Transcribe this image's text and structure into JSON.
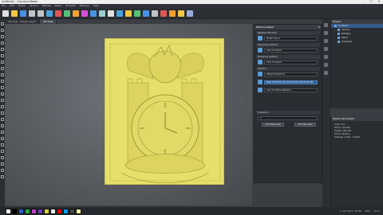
{
  "titlebar": {
    "title": "Untitled1 - Carveco Maker",
    "minimize": "–",
    "maximize": "□",
    "close": "✕"
  },
  "menubar": [
    "File",
    "Edit",
    "Model",
    "Vectors",
    "Bitmap",
    "Relief",
    "Toolpath",
    "Window",
    "Help"
  ],
  "tabs": [
    {
      "label": "2D View - Design Layer",
      "active": false
    },
    {
      "label": "3D View",
      "active": true
    }
  ],
  "toolbar_icons": [
    "new-icon",
    "open-icon",
    "save-icon",
    "undo-icon",
    "redo-icon",
    "vector-icon",
    "node-icon",
    "transform-icon",
    "bitmap-icon",
    "relief-icon",
    "shape-icon",
    "layer-icon",
    "merge-icon",
    "smooth-icon",
    "sculpt-icon",
    "toolpath-icon",
    "simulate-icon",
    "export-icon",
    "render-icon",
    "colour-icon",
    "light-icon",
    "view-icon"
  ],
  "palette_colors": [
    "#ffffff",
    "#000000",
    "#2b5fd1",
    "#2fa84c",
    "#c13cc1",
    "#6b3bc4",
    "#d9d435",
    "#e8e8e8",
    "#ff0000",
    "#00a0e9",
    "#444444",
    "#f2f2a0"
  ],
  "panel": {
    "title": "Machine Relief",
    "close": "✕",
    "sections": [
      {
        "title": "Relative Machine",
        "field": "Model (top) ▾",
        "field_selected": false
      },
      {
        "title": "Roughing Options",
        "field": "Click To Select...",
        "field_selected": false
      },
      {
        "title": "Roughing Options",
        "field": "Click To Select...",
        "field_selected": false
      },
      {
        "title": "Options",
        "field": "Offset To Machine",
        "field_selected": false
      },
      {
        "title": "",
        "field": "Built 0.25 9.52 mm Conoid Tol 0.05 (0.25-48)",
        "field_selected": true
      },
      {
        "title": "",
        "field": "Click To Define Material...",
        "field_selected": false
      }
    ],
    "footer_title": "Tolerance",
    "footer_value": "3",
    "calc_later_button": "Calculate Later",
    "calc_now_button": "Calculate Now"
  },
  "tree": {
    "title": "Project",
    "items": [
      {
        "label": "Untitled1",
        "selected": true
      },
      {
        "label": "Vectors",
        "selected": false
      },
      {
        "label": "Bitmaps",
        "selected": false
      },
      {
        "label": "Relief",
        "selected": false
      },
      {
        "label": "Toolpaths",
        "selected": false
      }
    ]
  },
  "model_info": {
    "title": "Model Information",
    "lines": [
      "Units: mm",
      "Width: 150.000",
      "Height: 184.000",
      "Z Zero: Bottom",
      "Z Range: 0.000 - 12.500"
    ]
  },
  "status": {
    "coords": "X: 123.456  Y: 78.900",
    "zoom": "100%",
    "time": "10:11"
  }
}
